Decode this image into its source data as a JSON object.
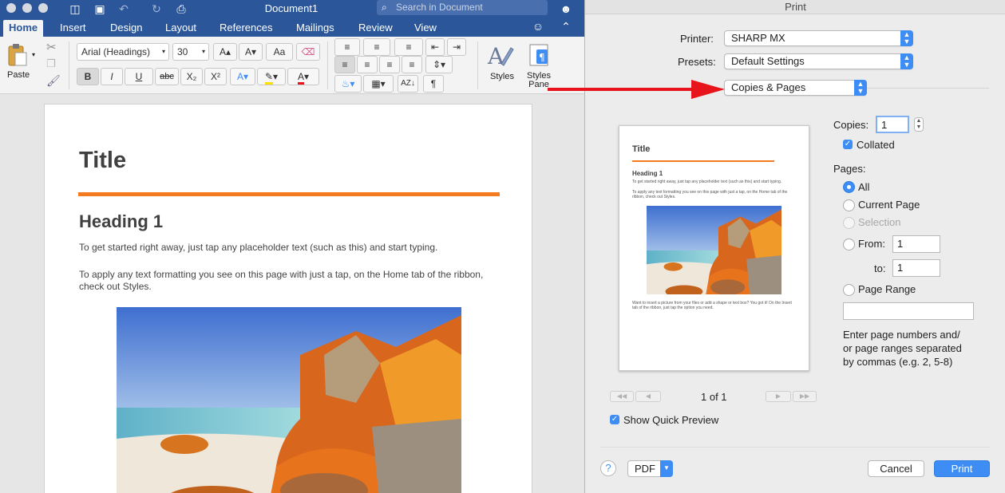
{
  "word": {
    "doc_title": "Document1",
    "search_placeholder": "Search in Document",
    "tabs": [
      "Home",
      "Insert",
      "Design",
      "Layout",
      "References",
      "Mailings",
      "Review",
      "View"
    ],
    "ribbon": {
      "paste_label": "Paste",
      "font_name": "Arial (Headings)",
      "font_size": "30",
      "grow_font": "A▴",
      "shrink_font": "A▾",
      "case_btn": "Aa",
      "bold": "B",
      "italic": "I",
      "underline": "U",
      "strike": "abc",
      "subscript": "X₂",
      "superscript": "X²",
      "pilcrow": "¶",
      "styles_label": "Styles",
      "styles_pane_label": "Styles\nPane"
    },
    "page": {
      "title": "Title",
      "heading": "Heading 1",
      "para1": "To get started right away, just tap any placeholder text (such as this) and start typing.",
      "para2": "To apply any text formatting you see on this page with just a tap, on the Home tab of the ribbon, check out Styles."
    }
  },
  "dialog": {
    "title": "Print",
    "printer_label": "Printer:",
    "printer_value": "SHARP MX",
    "presets_label": "Presets:",
    "presets_value": "Default Settings",
    "section_value": "Copies & Pages",
    "preview": {
      "title": "Title",
      "heading": "Heading 1",
      "p1": "To get started right away, just tap any placeholder text (such as this) and start typing.",
      "p2": "To apply any text formatting you see on this page with just a tap, on the Home tab of the ribbon, check out Styles.",
      "p3": "Want to insert a picture from your files or add a shape or text box? You got it! On the Insert tab of the ribbon, just tap the option you need."
    },
    "page_counter": "1 of 1",
    "nav_first": "◀◀",
    "nav_prev": "◀",
    "nav_next": "▶",
    "nav_last": "▶▶",
    "copies_label": "Copies:",
    "copies_value": "1",
    "collated_label": "Collated",
    "pages_label": "Pages:",
    "opt_all": "All",
    "opt_current": "Current Page",
    "opt_selection": "Selection",
    "opt_from": "From:",
    "from_value": "1",
    "to_label": "to:",
    "to_value": "1",
    "opt_range": "Page Range",
    "range_value": "",
    "range_hint": "Enter page numbers and/\nor page ranges separated\nby commas (e.g. 2, 5-8)",
    "quick_preview_label": "Show Quick Preview",
    "help": "?",
    "pdf_label": "PDF",
    "cancel_label": "Cancel",
    "print_label": "Print"
  },
  "colors": {
    "word_blue": "#2b579a",
    "accent_orange": "#f47b20",
    "mac_blue": "#3d8df5",
    "arrow_red": "#e8141b"
  }
}
